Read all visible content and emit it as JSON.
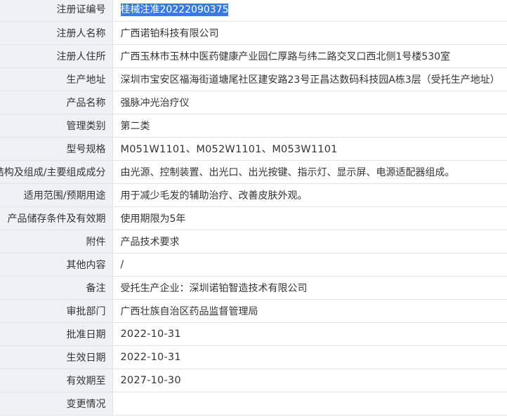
{
  "rows": [
    {
      "label": "注册证编号",
      "value": "桂械注准20222090375",
      "selected": true
    },
    {
      "label": "注册人名称",
      "value": "广西诺铂科技有限公司"
    },
    {
      "label": "注册人住所",
      "value": "广西玉林市玉林中医药健康产业园仁厚路与纬二路交叉口西北侧1号楼530室"
    },
    {
      "label": "生产地址",
      "value": "深圳市宝安区福海街道塘尾社区建安路23号正昌达数码科技园A栋3层（受托生产地址）"
    },
    {
      "label": "产品名称",
      "value": "强脉冲光治疗仪"
    },
    {
      "label": "管理类别",
      "value": "第二类"
    },
    {
      "label": "型号规格",
      "value": "M051W1101、M052W1101、M053W1101",
      "num": true
    },
    {
      "label": "结构及组成/主要组成成分",
      "value": "由光源、控制装置、出光口、出光按键、指示灯、显示屏、电源适配器组成。"
    },
    {
      "label": "适用范围/预期用途",
      "value": "用于减少毛发的辅助治疗、改善皮肤外观。"
    },
    {
      "label": "产品储存条件及有效期",
      "value": "使用期限为5年"
    },
    {
      "label": "附件",
      "value": "产品技术要求"
    },
    {
      "label": "其他内容",
      "value": "/"
    },
    {
      "label": "备注",
      "value": "受托生产企业：深圳诺铂智造技术有限公司"
    },
    {
      "label": "审批部门",
      "value": "广西壮族自治区药品监督管理局"
    },
    {
      "label": "批准日期",
      "value": "2022-10-31",
      "num": true
    },
    {
      "label": "生效日期",
      "value": "2022-10-31",
      "num": true
    },
    {
      "label": "有效期至",
      "value": "2027-10-30",
      "num": true
    },
    {
      "label": "变更情况",
      "value": ""
    }
  ]
}
